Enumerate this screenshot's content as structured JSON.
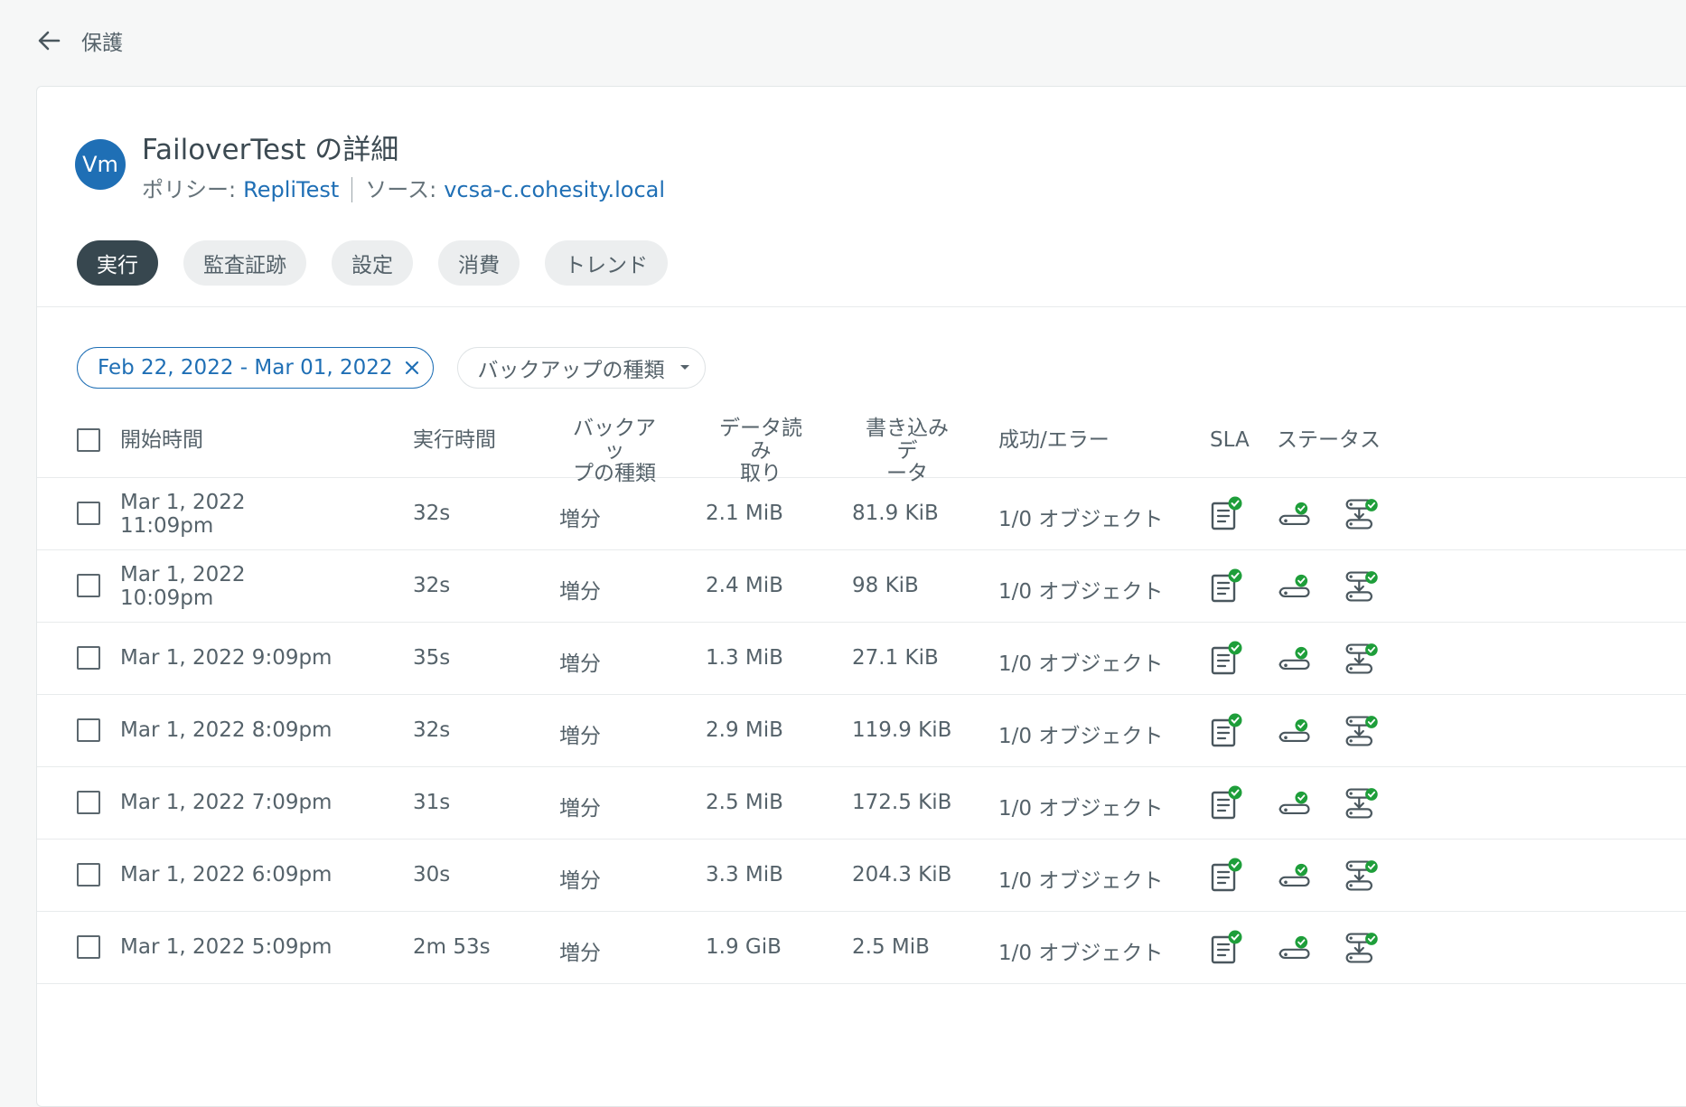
{
  "topbar": {
    "title": "保護"
  },
  "header": {
    "avatar_text": "Vm",
    "title": "FailoverTest の詳細",
    "policy_label": "ポリシー:",
    "policy_value": "RepliTest",
    "source_label": "ソース:",
    "source_value": "vcsa-c.cohesity.local"
  },
  "tabs": [
    {
      "label": "実行",
      "active": true
    },
    {
      "label": "監査証跡",
      "active": false
    },
    {
      "label": "設定",
      "active": false
    },
    {
      "label": "消費",
      "active": false
    },
    {
      "label": "トレンド",
      "active": false
    }
  ],
  "filters": {
    "date_range": "Feb 22, 2022 - Mar 01, 2022",
    "backup_type_label": "バックアップの種類"
  },
  "table": {
    "headers": {
      "start": "開始時間",
      "duration": "実行時間",
      "type_line1": "バックアッ",
      "type_line2": "プの種類",
      "read_line1": "データ読み",
      "read_line2": "取り",
      "write_line1": "書き込みデ",
      "write_line2": "ータ",
      "result": "成功/エラー",
      "sla": "SLA",
      "status": "ステータス"
    },
    "rows": [
      {
        "start_line1": "Mar 1, 2022",
        "start_line2": "11:09pm",
        "duration": "32s",
        "type": "増分",
        "read": "2.1 MiB",
        "write": "81.9 KiB",
        "result": "1/0 オブジェクト"
      },
      {
        "start_line1": "Mar 1, 2022",
        "start_line2": "10:09pm",
        "duration": "32s",
        "type": "増分",
        "read": "2.4 MiB",
        "write": "98 KiB",
        "result": "1/0 オブジェクト"
      },
      {
        "start_line1": "Mar 1, 2022 9:09pm",
        "start_line2": "",
        "duration": "35s",
        "type": "増分",
        "read": "1.3 MiB",
        "write": "27.1 KiB",
        "result": "1/0 オブジェクト"
      },
      {
        "start_line1": "Mar 1, 2022 8:09pm",
        "start_line2": "",
        "duration": "32s",
        "type": "増分",
        "read": "2.9 MiB",
        "write": "119.9 KiB",
        "result": "1/0 オブジェクト"
      },
      {
        "start_line1": "Mar 1, 2022 7:09pm",
        "start_line2": "",
        "duration": "31s",
        "type": "増分",
        "read": "2.5 MiB",
        "write": "172.5 KiB",
        "result": "1/0 オブジェクト"
      },
      {
        "start_line1": "Mar 1, 2022 6:09pm",
        "start_line2": "",
        "duration": "30s",
        "type": "増分",
        "read": "3.3 MiB",
        "write": "204.3 KiB",
        "result": "1/0 オブジェクト"
      },
      {
        "start_line1": "Mar 1, 2022 5:09pm",
        "start_line2": "",
        "duration": "2m 53s",
        "type": "増分",
        "read": "1.9 GiB",
        "write": "2.5 MiB",
        "result": "1/0 オブジェクト"
      }
    ]
  },
  "icons": {
    "back": "arrow-left-icon",
    "close": "close-icon",
    "caret": "caret-down-icon",
    "sla": "sla-report-check-icon",
    "replication": "replication-check-icon",
    "archive": "archive-check-icon"
  },
  "colors": {
    "accent": "#1f6fb5",
    "success": "#1e9e3a",
    "active_tab": "#37474f"
  }
}
